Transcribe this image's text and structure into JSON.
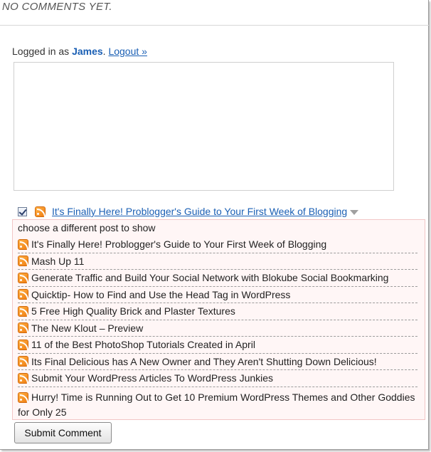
{
  "comments": {
    "heading": "NO COMMENTS YET."
  },
  "auth": {
    "prefix": "Logged in as ",
    "username": "James",
    "separator": ". ",
    "logout": "Logout »"
  },
  "comment_form": {
    "text_value": ""
  },
  "commentluv": {
    "checked": true,
    "selected_post": "It's Finally Here! Problogger's Guide to Your First Week of Blogging",
    "panel_title": "choose a different post to show",
    "posts": [
      "It's Finally Here! Problogger's Guide to Your First Week of Blogging",
      "Mash Up 11",
      "Generate Traffic and Build Your Social Network with Blokube Social Bookmarking",
      "Quicktip- How to Find and Use the Head Tag in WordPress",
      "5 Free High Quality Brick and Plaster Textures",
      "The New Klout – Preview",
      "11 of the Best PhotoShop Tutorials Created in April",
      "Its Final Delicious has A New Owner and They Aren't Shutting Down Delicious!",
      "Submit Your WordPress Articles To WordPress Junkies",
      "Hurry! Time is Running Out to Get 10 Premium WordPress Themes and Other Goddies for Only 25"
    ]
  },
  "actions": {
    "submit_label": "Submit Comment"
  },
  "icons": {
    "feed": "rss-icon",
    "dropdown": "chevron-down-icon"
  },
  "colors": {
    "link": "#1a5fb4",
    "panel_border": "#f2c6c6",
    "panel_background": "#fff6f6"
  }
}
